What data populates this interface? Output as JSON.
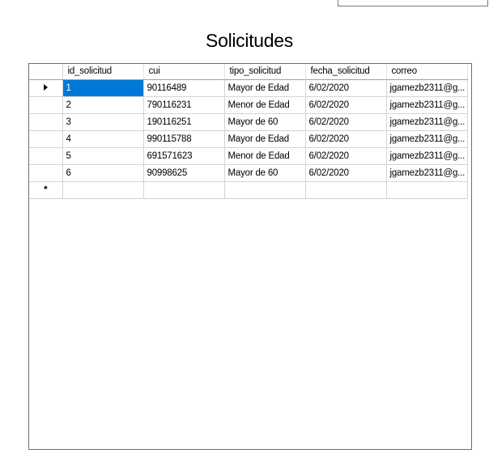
{
  "title": "Solicitudes",
  "grid": {
    "columns": [
      "id_solicitud",
      "cui",
      "tipo_solicitud",
      "fecha_solicitud",
      "correo"
    ],
    "rows": [
      [
        "1",
        "90116489",
        "Mayor de Edad",
        "6/02/2020",
        "jgamezb2311@g..."
      ],
      [
        "2",
        "790116231",
        "Menor de Edad",
        "6/02/2020",
        "jgamezb2311@g..."
      ],
      [
        "3",
        "190116251",
        "Mayor de 60",
        "6/02/2020",
        "jgamezb2311@g..."
      ],
      [
        "4",
        "990115788",
        "Mayor de Edad",
        "6/02/2020",
        "jgamezb2311@g..."
      ],
      [
        "5",
        "691571623",
        "Menor de Edad",
        "6/02/2020",
        "jgamezb2311@g..."
      ],
      [
        "6",
        "90998625",
        "Mayor de 60",
        "6/02/2020",
        "jgamezb2311@g..."
      ]
    ],
    "current_row_indicator": "arrow-right-icon",
    "new_row_indicator": "*",
    "selected_cell": {
      "row": 0,
      "column": 0
    },
    "selection_color": "#0078d7"
  }
}
